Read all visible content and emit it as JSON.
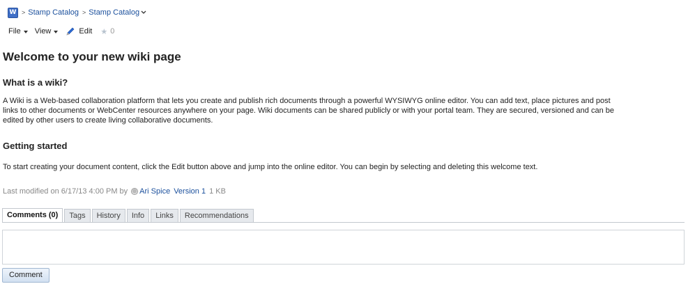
{
  "breadcrumb": {
    "logo_letter": "W",
    "separator": ">",
    "items": [
      "Stamp Catalog",
      "Stamp Catalog"
    ]
  },
  "toolbar": {
    "file_label": "File",
    "view_label": "View",
    "edit_label": "Edit",
    "rating_count": "0"
  },
  "content": {
    "title": "Welcome to your new wiki page",
    "section1_heading": "What is a wiki?",
    "section1_lines": [
      "A Wiki is a Web-based collaboration platform that lets you create and publish rich documents through a powerful WYSIWYG online editor. You can add text, place pictures and post",
      "links to other documents or WebCenter resources anywhere on your page. Wiki documents can be shared publicly or with your portal team. They are secured, versioned and can be",
      "edited by other users to create living collaborative documents."
    ],
    "section2_heading": "Getting started",
    "section2_text": "To start creating your document content, click the Edit button above and jump into the online editor. You can begin by selecting and deleting this welcome text."
  },
  "meta": {
    "last_modified_label": "Last modified on 6/17/13 4:00 PM  by",
    "author": "Ari Spice",
    "version": "Version 1",
    "size": "1 KB"
  },
  "tabs": [
    {
      "label": "Comments (0)",
      "active": true
    },
    {
      "label": "Tags",
      "active": false
    },
    {
      "label": "History",
      "active": false
    },
    {
      "label": "Info",
      "active": false
    },
    {
      "label": "Links",
      "active": false
    },
    {
      "label": "Recommendations",
      "active": false
    }
  ],
  "comment": {
    "value": "",
    "button_label": "Comment"
  },
  "colors": {
    "link": "#1a4f9c",
    "logo": "#3f6fc7",
    "tab_bg": "#e6e9ed",
    "button_bg": "#d2e1f1"
  }
}
